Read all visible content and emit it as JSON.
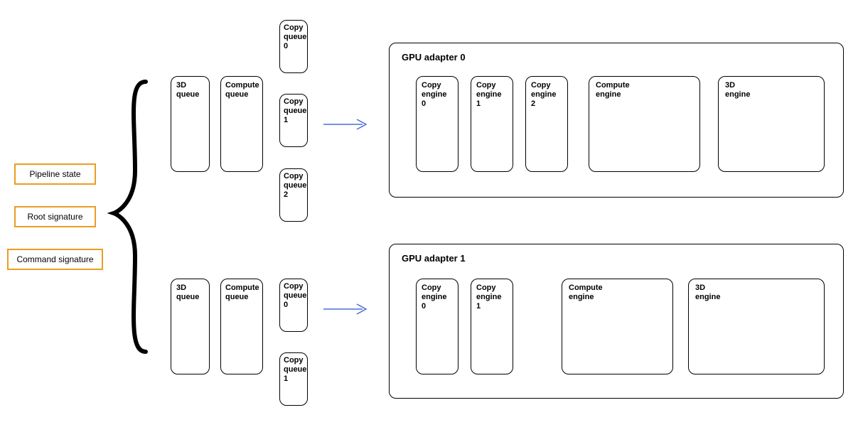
{
  "left_boxes": {
    "pipeline": "Pipeline state",
    "root": "Root signature",
    "cmdsig": "Command signature"
  },
  "top": {
    "queues": {
      "q3d": "3D\nqueue",
      "qcompute": "Compute\nqueue",
      "copy0": "Copy\nqueue\n0",
      "copy1": "Copy\nqueue\n1",
      "copy2": "Copy\nqueue\n2"
    },
    "adapter": {
      "title": "GPU adapter 0",
      "engines": {
        "ce0": "Copy\nengine\n0",
        "ce1": "Copy\nengine\n1",
        "ce2": "Copy\nengine\n2",
        "comp": "Compute\nengine",
        "d3d": "3D\nengine"
      }
    }
  },
  "bottom": {
    "queues": {
      "q3d": "3D\nqueue",
      "qcompute": "Compute\nqueue",
      "copy0": "Copy\nqueue\n0",
      "copy1": "Copy\nqueue\n1"
    },
    "adapter": {
      "title": "GPU adapter 1",
      "engines": {
        "ce0": "Copy\nengine\n0",
        "ce1": "Copy\nengine\n1",
        "comp": "Compute\nengine",
        "d3d": "3D\nengine"
      }
    }
  }
}
